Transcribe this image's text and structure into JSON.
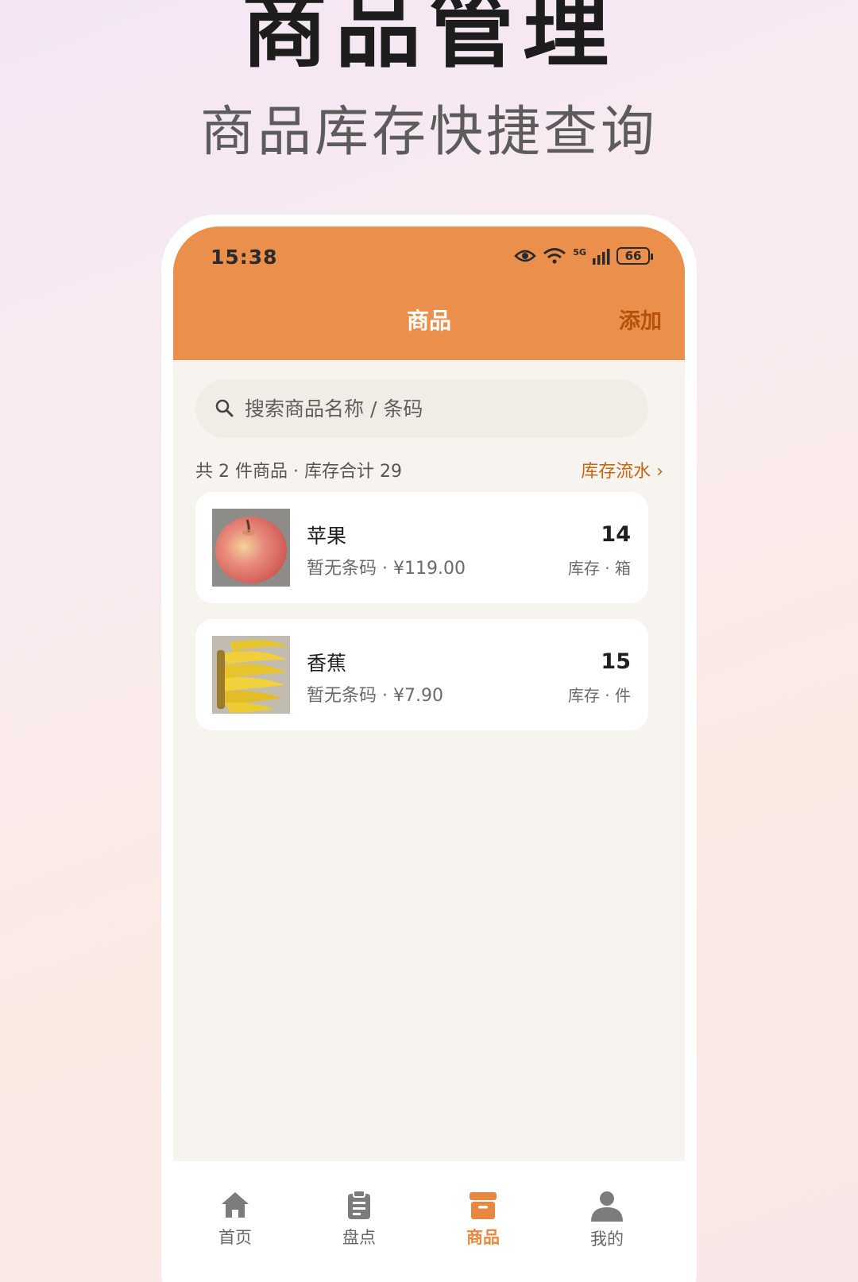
{
  "hero": {
    "title": "商品管理",
    "subtitle": "商品库存快捷查询"
  },
  "status_bar": {
    "time": "15:38",
    "network": "5G",
    "battery": "66",
    "icons": [
      "eye-icon",
      "wifi-icon",
      "cellular-signal-icon",
      "battery-icon"
    ]
  },
  "appbar": {
    "title": "商品",
    "add_label": "添加"
  },
  "search": {
    "placeholder": "搜索商品名称 / 条码"
  },
  "summary": {
    "text": "共 2 件商品 · 库存合计 29",
    "ledger_link": "库存流水 ›"
  },
  "products": [
    {
      "name": "苹果",
      "meta": "暂无条码 · ¥119.00",
      "quantity": "14",
      "unit_label": "库存 · 箱",
      "image": "apple"
    },
    {
      "name": "香蕉",
      "meta": "暂无条码 · ¥7.90",
      "quantity": "15",
      "unit_label": "库存 · 件",
      "image": "bananas"
    }
  ],
  "tabbar": {
    "items": [
      {
        "label": "首页",
        "icon": "home-icon",
        "active": false
      },
      {
        "label": "盘点",
        "icon": "clipboard-icon",
        "active": false
      },
      {
        "label": "商品",
        "icon": "archive-box-icon",
        "active": true
      },
      {
        "label": "我的",
        "icon": "person-icon",
        "active": false
      }
    ]
  },
  "colors": {
    "accent": "#eb8f4d",
    "accent_dark": "#b4520b",
    "link": "#c8630f",
    "tab_active": "#e8873f"
  }
}
